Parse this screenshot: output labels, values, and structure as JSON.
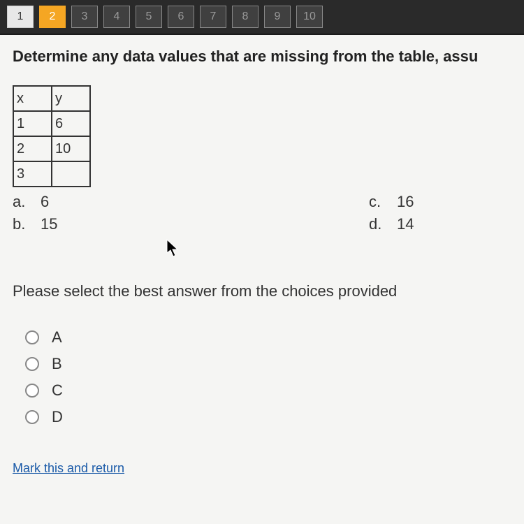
{
  "nav": {
    "items": [
      {
        "label": "1",
        "state": "completed"
      },
      {
        "label": "2",
        "state": "active"
      },
      {
        "label": "3",
        "state": "default"
      },
      {
        "label": "4",
        "state": "default"
      },
      {
        "label": "5",
        "state": "default"
      },
      {
        "label": "6",
        "state": "default"
      },
      {
        "label": "7",
        "state": "default"
      },
      {
        "label": "8",
        "state": "default"
      },
      {
        "label": "9",
        "state": "default"
      },
      {
        "label": "10",
        "state": "default"
      }
    ]
  },
  "question": {
    "prompt": "Determine any data values that are missing from the table, assu",
    "table": {
      "headers": {
        "col1": "x",
        "col2": "y"
      },
      "rows": [
        {
          "c1": "1",
          "c2": "6"
        },
        {
          "c1": "2",
          "c2": "10"
        },
        {
          "c1": "3",
          "c2": ""
        }
      ]
    },
    "choices": {
      "a": {
        "letter": "a.",
        "value": "6"
      },
      "b": {
        "letter": "b.",
        "value": "15"
      },
      "c": {
        "letter": "c.",
        "value": "16"
      },
      "d": {
        "letter": "d.",
        "value": "14"
      }
    },
    "instruction": "Please select the best answer from the choices provided",
    "radios": {
      "a": "A",
      "b": "B",
      "c": "C",
      "d": "D"
    }
  },
  "footer": {
    "mark_return": "Mark this and return"
  }
}
